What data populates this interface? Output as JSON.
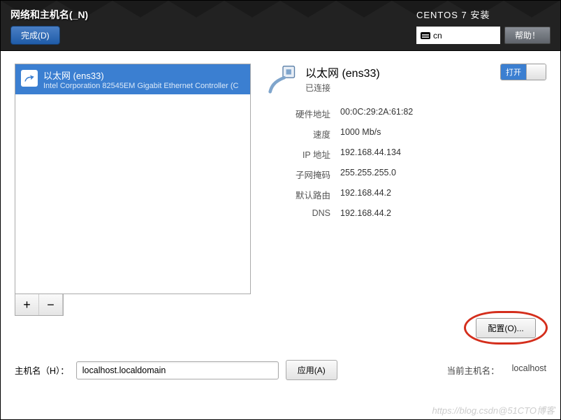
{
  "header": {
    "title": "网络和主机名(_N)",
    "done": "完成(D)",
    "install_title": "CENTOS 7 安装",
    "keyboard": "cn",
    "help": "帮助！"
  },
  "device": {
    "name": "以太网 (ens33)",
    "desc": "Intel Corporation 82545EM Gigabit Ethernet Controller (C"
  },
  "pm": {
    "plus": "+",
    "minus": "−"
  },
  "connection": {
    "title": "以太网 (ens33)",
    "status": "已连接",
    "toggle_on": "打开"
  },
  "info": {
    "hw_label": "硬件地址",
    "hw_value": "00:0C:29:2A:61:82",
    "speed_label": "速度",
    "speed_value": "1000 Mb/s",
    "ip_label": "IP 地址",
    "ip_value": "192.168.44.134",
    "mask_label": "子网掩码",
    "mask_value": "255.255.255.0",
    "gateway_label": "默认路由",
    "gateway_value": "192.168.44.2",
    "dns_label": "DNS",
    "dns_value": "192.168.44.2"
  },
  "config_btn": "配置(O)...",
  "hostname": {
    "label": "主机名（H）：",
    "value": "localhost.localdomain",
    "apply": "应用(A)",
    "current_label": "当前主机名：",
    "current_value": "localhost"
  },
  "watermark": "https://blog.csdn@51CTO博客"
}
